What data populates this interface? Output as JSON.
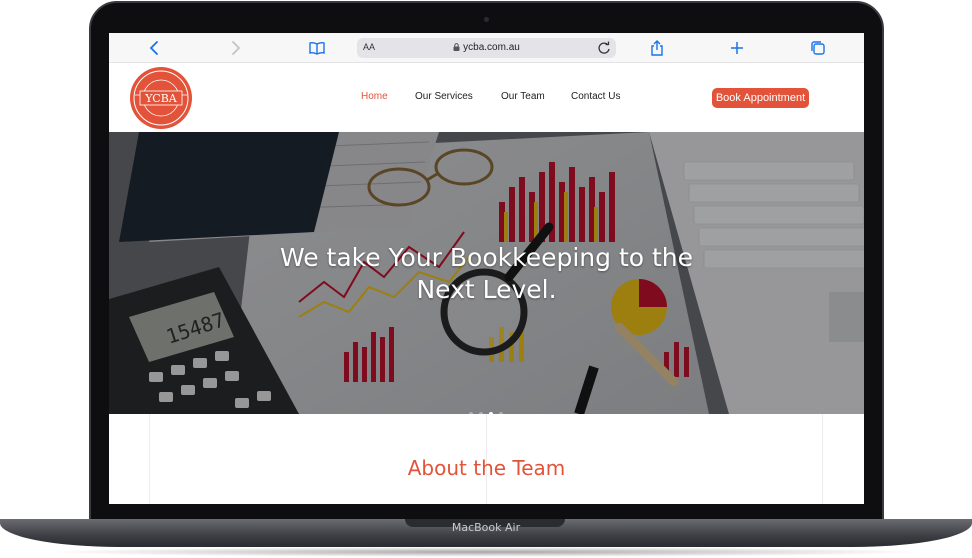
{
  "device": {
    "label": "MacBook Air"
  },
  "browser": {
    "reader_label": "AA",
    "url": "ycba.com.au"
  },
  "site": {
    "logo": {
      "text": "YCBA",
      "ring_text": "YOUR COMPLETE · BUSINESS ASSISTANT"
    },
    "nav": [
      {
        "label": "Home",
        "active": true
      },
      {
        "label": "Our Services",
        "active": false
      },
      {
        "label": "Our Team",
        "active": false
      },
      {
        "label": "Contact Us",
        "active": false
      }
    ],
    "cta_label": "Book Appointment"
  },
  "hero": {
    "title_line1": "We take Your Bookkeeping to the",
    "title_line2": "Next Level.",
    "calculator_display": "15487",
    "slide_count": 4,
    "active_slide": 3
  },
  "about": {
    "title": "About the Team"
  },
  "colors": {
    "accent": "#e2533a",
    "toolbar_icon": "#1a73e8"
  }
}
